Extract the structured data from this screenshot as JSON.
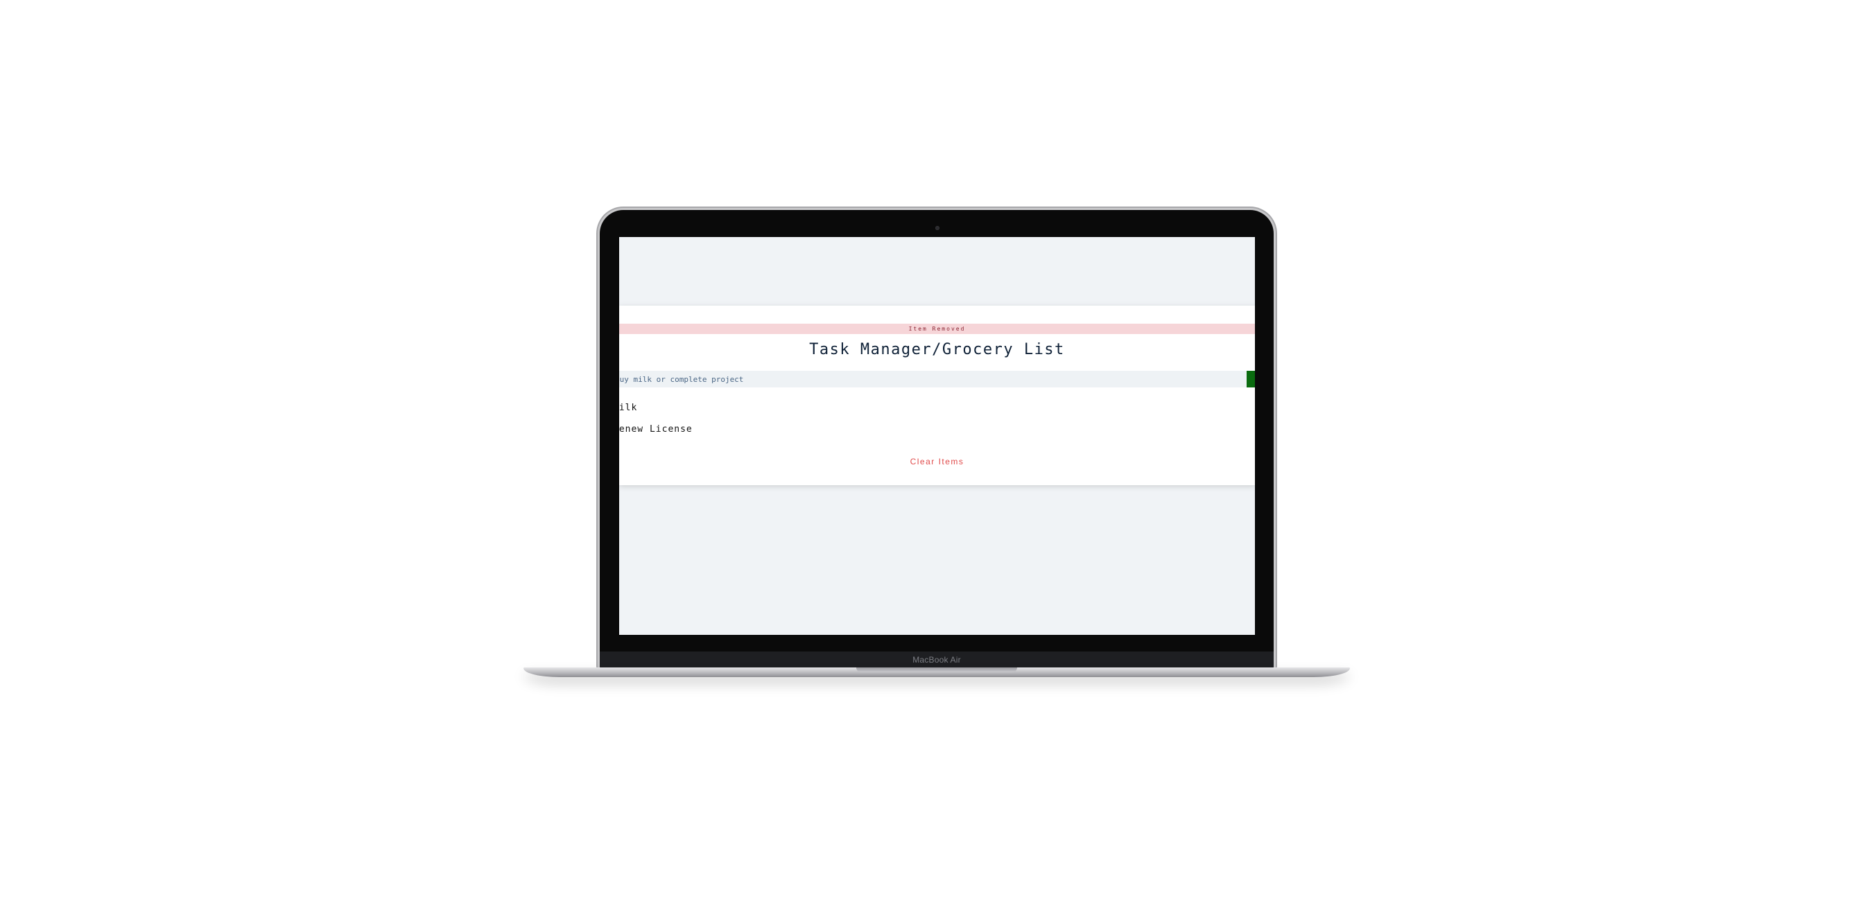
{
  "device": {
    "brand_label": "MacBook Air"
  },
  "app": {
    "alert_message": "Item Removed",
    "title": "Task Manager/Grocery List",
    "input": {
      "value": "",
      "placeholder": "Buy milk or complete project"
    },
    "add_button": {
      "label": "",
      "color": "#0a6b0f"
    },
    "items": [
      {
        "label": "Milk"
      },
      {
        "label": "Renew License"
      }
    ],
    "clear_button_label": "Clear Items"
  },
  "colors": {
    "alert_background": "#f6d5d8",
    "alert_text": "#8a2230",
    "title_text": "#0f2137",
    "clear_text": "#e04a4a",
    "page_background": "#f0f3f6"
  }
}
